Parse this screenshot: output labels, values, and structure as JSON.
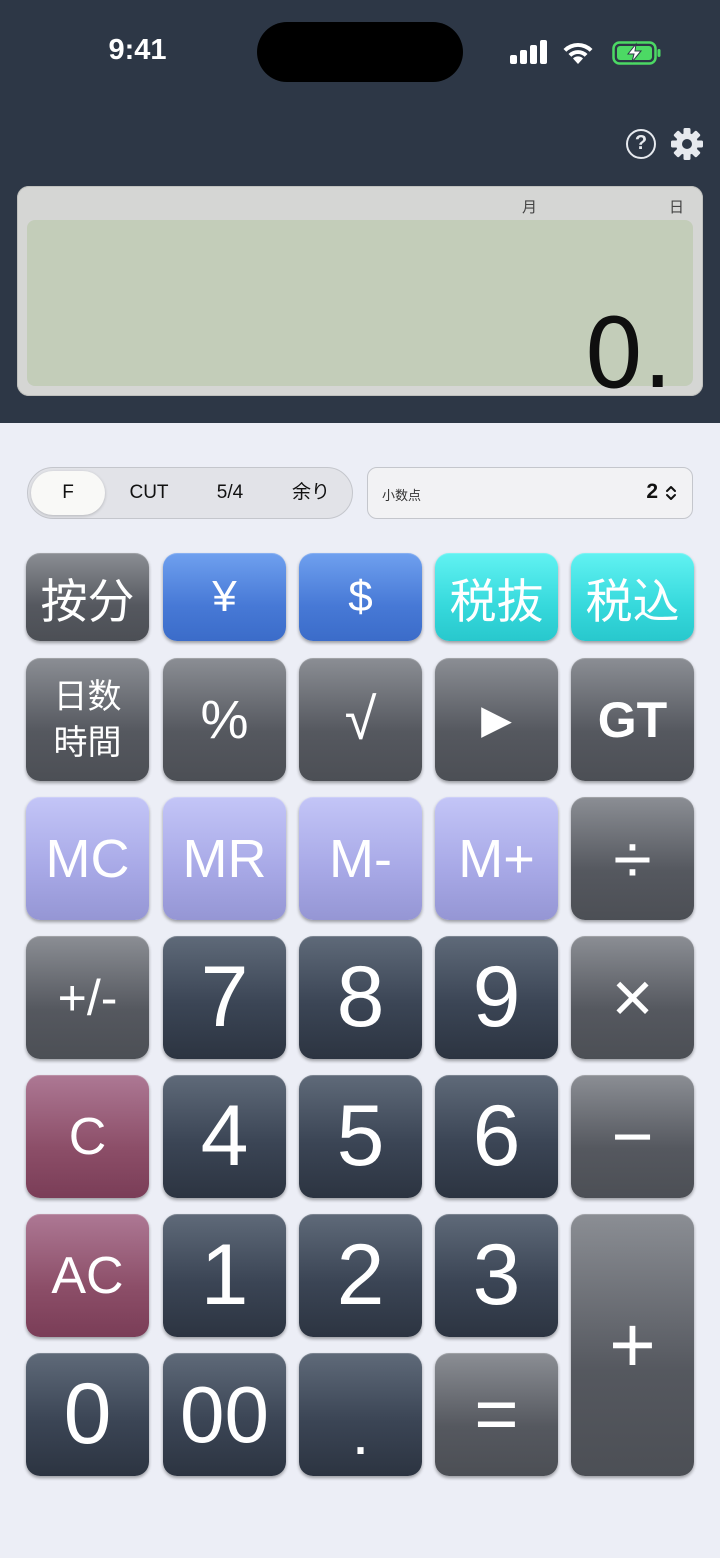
{
  "status": {
    "time": "9:41"
  },
  "display": {
    "month_label": "月",
    "day_label": "日",
    "value": "0."
  },
  "modes": {
    "items": [
      "F",
      "CUT",
      "5/4",
      "余り"
    ],
    "active": "F"
  },
  "decimal": {
    "label": "小数点",
    "value": "2"
  },
  "keys": {
    "prorate": "按分",
    "yen": "¥",
    "dollar": "$",
    "tax_exclude": "税抜",
    "tax_include": "税込",
    "days_time_line1": "日数",
    "days_time_line2": "時間",
    "percent": "%",
    "sqrt": "√",
    "play": "▶",
    "gt": "GT",
    "mc": "MC",
    "mr": "MR",
    "m_minus": "M-",
    "m_plus": "M+",
    "divide": "÷",
    "sign": "+/-",
    "seven": "7",
    "eight": "8",
    "nine": "9",
    "multiply": "×",
    "clear": "C",
    "four": "4",
    "five": "5",
    "six": "6",
    "minus": "−",
    "all_clear": "AC",
    "one": "1",
    "two": "2",
    "three": "3",
    "plus": "+",
    "zero": "0",
    "double_zero": "00",
    "decimal_point": ".",
    "equals": "="
  },
  "colors": {
    "header_bg": "#2d3746",
    "lcd_bg": "#c3cdb9",
    "body_bg": "#eceef6",
    "battery_green": "#4cd964"
  }
}
